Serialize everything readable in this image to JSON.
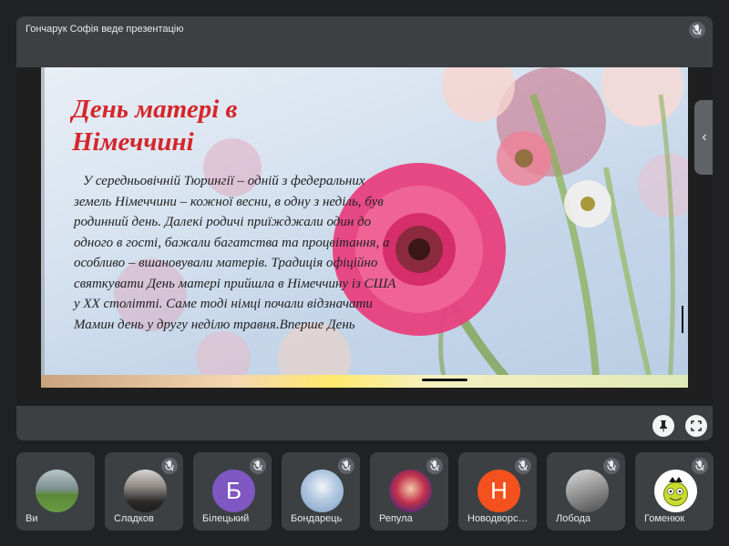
{
  "presenter": {
    "label": "Гончарук Софія веде презентацію",
    "muted": true
  },
  "slide": {
    "title_line1": "День матері в",
    "title_line2": "Німеччині",
    "paragraph": "У середньовічній Тюрингії – одній з федеральних земель Німеччини – кожної весни, в одну з неділь, був родинний день. Далекі родичі приїжджали один до одного в гості, бажали багатства та процвітання, а особливо – вшановували матерів. Традиція офіційно святкувати День матері прийшла в Німеччину із США у ХХ столітті. Саме тоді німці почали відзначати Мамин день у другу неділю травня.Вперше День"
  },
  "controls": {
    "pin_icon": "pin-icon",
    "fullscreen_icon": "fullscreen-icon",
    "side_panel_icon": "chevron-left-icon"
  },
  "participants": [
    {
      "name": "Ви",
      "initial": "",
      "avatar_color": "#6d8a52",
      "muted": false
    },
    {
      "name": "Сладков",
      "initial": "",
      "avatar_color": "#a9a29a",
      "muted": true
    },
    {
      "name": "Білецький",
      "initial": "Б",
      "avatar_color": "#7e57c2",
      "muted": true
    },
    {
      "name": "Бондарець",
      "initial": "",
      "avatar_color": "#8fb4d8",
      "muted": true
    },
    {
      "name": "Репула",
      "initial": "",
      "avatar_color": "#b4233b",
      "muted": true
    },
    {
      "name": "Новодворс…",
      "initial": "Н",
      "avatar_color": "#f4511e",
      "muted": true
    },
    {
      "name": "Лобода",
      "initial": "",
      "avatar_color": "#9e9e9e",
      "muted": true
    },
    {
      "name": "Гоменюк",
      "initial": "",
      "avatar_color": "#ffffff",
      "muted": true
    }
  ]
}
